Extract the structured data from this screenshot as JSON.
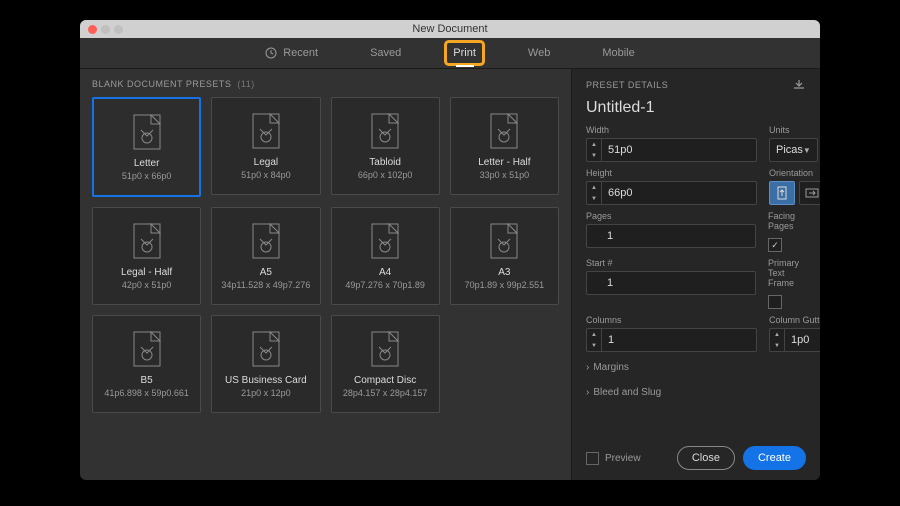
{
  "window": {
    "title": "New Document"
  },
  "tabs": [
    {
      "icon": "clock-icon",
      "label": "Recent"
    },
    {
      "icon": null,
      "label": "Saved"
    },
    {
      "icon": null,
      "label": "Print",
      "active": true,
      "highlighted": true
    },
    {
      "icon": null,
      "label": "Web"
    },
    {
      "icon": null,
      "label": "Mobile"
    }
  ],
  "presets": {
    "title": "BLANK DOCUMENT PRESETS",
    "count": "(11)",
    "cards": [
      {
        "name": "Letter",
        "dims": "51p0 x 66p0",
        "selected": true
      },
      {
        "name": "Legal",
        "dims": "51p0 x 84p0"
      },
      {
        "name": "Tabloid",
        "dims": "66p0 x 102p0"
      },
      {
        "name": "Letter - Half",
        "dims": "33p0 x 51p0"
      },
      {
        "name": "Legal - Half",
        "dims": "42p0 x 51p0"
      },
      {
        "name": "A5",
        "dims": "34p11.528 x 49p7.276"
      },
      {
        "name": "A4",
        "dims": "49p7.276 x 70p1.89"
      },
      {
        "name": "A3",
        "dims": "70p1.89 x 99p2.551"
      },
      {
        "name": "B5",
        "dims": "41p6.898 x 59p0.661"
      },
      {
        "name": "US Business Card",
        "dims": "21p0 x 12p0"
      },
      {
        "name": "Compact Disc",
        "dims": "28p4.157 x 28p4.157"
      }
    ]
  },
  "details": {
    "header": "PRESET DETAILS",
    "doc_name": "Untitled-1",
    "width": {
      "label": "Width",
      "value": "51p0"
    },
    "height": {
      "label": "Height",
      "value": "66p0"
    },
    "units": {
      "label": "Units",
      "value": "Picas"
    },
    "orientation": {
      "label": "Orientation"
    },
    "pages": {
      "label": "Pages",
      "value": "1"
    },
    "facing": {
      "label": "Facing Pages",
      "checked": true
    },
    "start": {
      "label": "Start #",
      "value": "1"
    },
    "primary_tf": {
      "label": "Primary Text Frame",
      "checked": false
    },
    "columns": {
      "label": "Columns",
      "value": "1"
    },
    "gutter": {
      "label": "Column Gutter",
      "value": "1p0"
    },
    "margins": "Margins",
    "bleed": "Bleed and Slug"
  },
  "footer": {
    "preview": "Preview",
    "close": "Close",
    "create": "Create"
  }
}
